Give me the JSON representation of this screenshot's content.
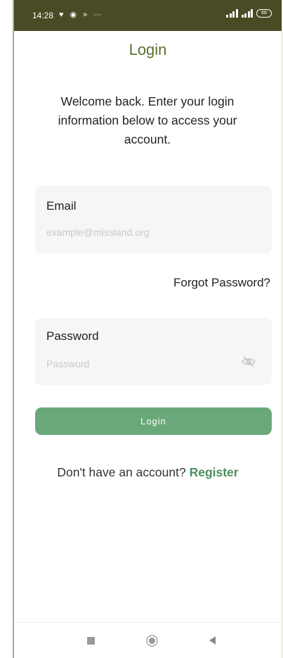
{
  "status_bar": {
    "time": "14:28",
    "notification_glyphs": [
      "♥",
      "◉",
      "»",
      "···"
    ],
    "battery_level": "68",
    "background": "#4a4a24"
  },
  "title": "Login",
  "welcome": "Welcome back. Enter your login information below to access your account.",
  "email": {
    "label": "Email",
    "placeholder": "example@missland.org",
    "value": ""
  },
  "forgot_password": "Forgot Password?",
  "password": {
    "label": "Password",
    "placeholder": "Password",
    "value": "",
    "toggle_icon": "eye-off-icon"
  },
  "login_button": "Login",
  "register_row": {
    "prompt": "Don't have an account?",
    "link": "Register"
  },
  "colors": {
    "title": "#5d7132",
    "button": "#6aa87a",
    "link": "#4e8f5f"
  },
  "nav_bar": {
    "icons": [
      "recents-icon",
      "home-icon",
      "back-icon"
    ]
  }
}
